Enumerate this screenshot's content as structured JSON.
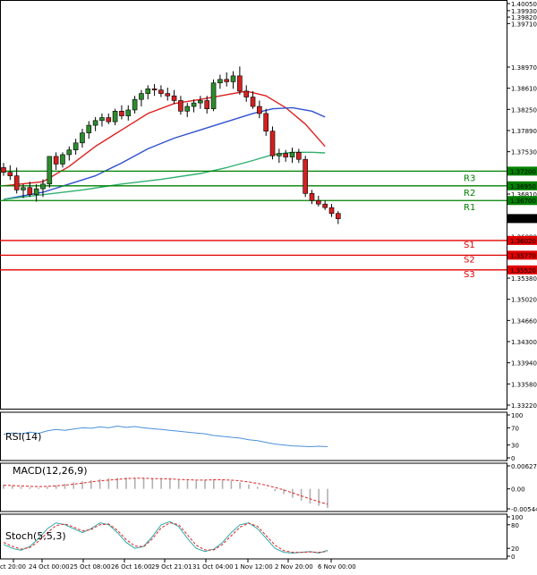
{
  "chart_data": {
    "type": "candlestick",
    "y_axis": {
      "range": [
        1.3322,
        1.4005
      ],
      "ticks": [
        "1.40050",
        "1.39930",
        "1.39820",
        "1.39710",
        "1.38970",
        "1.38610",
        "1.38250",
        "1.37890",
        "1.37530",
        "1.36810",
        "1.36090",
        "1.35380",
        "1.35020",
        "1.34660",
        "1.34300",
        "1.33940",
        "1.33580",
        "1.33220"
      ]
    },
    "x_axis_labels": [
      "ct 20:00",
      "24 Oct 00:00",
      "25 Oct 08:00",
      "26 Oct 16:00",
      "29 Oct 21:01",
      "31 Oct 04:00",
      "1 Nov 12:00",
      "2 Nov 20:00",
      "6 Nov 00:00"
    ],
    "last_price": "1.36393",
    "levels": [
      {
        "name": "R3",
        "value": 1.372,
        "label": "1.37200",
        "color": "#008000"
      },
      {
        "name": "R2",
        "value": 1.3695,
        "label": "1.36950",
        "color": "#008000"
      },
      {
        "name": "R1",
        "value": 1.367,
        "label": "1.36700",
        "color": "#008000"
      },
      {
        "name": "S1",
        "value": 1.3602,
        "label": "1.36020",
        "color": "#e00000"
      },
      {
        "name": "S2",
        "value": 1.3577,
        "label": "1.35770",
        "color": "#e00000"
      },
      {
        "name": "S3",
        "value": 1.3552,
        "label": "1.35520",
        "color": "#e00000"
      }
    ],
    "candles": [
      [
        1.3726,
        1.3734,
        1.3712,
        1.3718
      ],
      [
        1.3718,
        1.373,
        1.3705,
        1.3712
      ],
      [
        1.3712,
        1.3726,
        1.3682,
        1.3688
      ],
      [
        1.3688,
        1.3698,
        1.3674,
        1.3692
      ],
      [
        1.3692,
        1.3702,
        1.3676,
        1.368
      ],
      [
        1.368,
        1.3698,
        1.3668,
        1.369
      ],
      [
        1.369,
        1.3706,
        1.3676,
        1.3698
      ],
      [
        1.3698,
        1.3745,
        1.3692,
        1.3745
      ],
      [
        1.3745,
        1.3752,
        1.3722,
        1.3732
      ],
      [
        1.3732,
        1.3752,
        1.3726,
        1.3748
      ],
      [
        1.3748,
        1.3762,
        1.3738,
        1.3756
      ],
      [
        1.3756,
        1.3775,
        1.3748,
        1.3768
      ],
      [
        1.3768,
        1.3792,
        1.376,
        1.3785
      ],
      [
        1.3785,
        1.3805,
        1.3775,
        1.3798
      ],
      [
        1.3798,
        1.3812,
        1.3788,
        1.3806
      ],
      [
        1.3806,
        1.3818,
        1.3796,
        1.3811
      ],
      [
        1.3811,
        1.3818,
        1.38,
        1.3804
      ],
      [
        1.3804,
        1.3826,
        1.3798,
        1.3822
      ],
      [
        1.3822,
        1.3832,
        1.3808,
        1.3814
      ],
      [
        1.3814,
        1.3832,
        1.3806,
        1.3824
      ],
      [
        1.3824,
        1.3848,
        1.3818,
        1.3842
      ],
      [
        1.3842,
        1.3858,
        1.383,
        1.3852
      ],
      [
        1.3852,
        1.3866,
        1.3842,
        1.386
      ],
      [
        1.386,
        1.3868,
        1.3848,
        1.3858
      ],
      [
        1.3858,
        1.3866,
        1.3846,
        1.3852
      ],
      [
        1.3852,
        1.3862,
        1.384,
        1.3848
      ],
      [
        1.3848,
        1.3858,
        1.3834,
        1.384
      ],
      [
        1.384,
        1.3848,
        1.3816,
        1.3822
      ],
      [
        1.3822,
        1.3836,
        1.3812,
        1.383
      ],
      [
        1.383,
        1.3842,
        1.382,
        1.3836
      ],
      [
        1.3836,
        1.3848,
        1.3826,
        1.384
      ],
      [
        1.384,
        1.3848,
        1.3818,
        1.3826
      ],
      [
        1.3826,
        1.3876,
        1.3822,
        1.387
      ],
      [
        1.387,
        1.3884,
        1.386,
        1.3876
      ],
      [
        1.3876,
        1.3888,
        1.3864,
        1.3872
      ],
      [
        1.3872,
        1.389,
        1.386,
        1.3882
      ],
      [
        1.3882,
        1.3898,
        1.385,
        1.3856
      ],
      [
        1.3856,
        1.3866,
        1.3838,
        1.3846
      ],
      [
        1.3846,
        1.3856,
        1.3826,
        1.383
      ],
      [
        1.383,
        1.384,
        1.381,
        1.3818
      ],
      [
        1.3818,
        1.3826,
        1.378,
        1.3788
      ],
      [
        1.3788,
        1.3796,
        1.374,
        1.3746
      ],
      [
        1.3746,
        1.3758,
        1.3734,
        1.375
      ],
      [
        1.375,
        1.3756,
        1.3736,
        1.3744
      ],
      [
        1.3744,
        1.376,
        1.3734,
        1.3752
      ],
      [
        1.3752,
        1.3758,
        1.3734,
        1.374
      ],
      [
        1.374,
        1.3746,
        1.3676,
        1.3682
      ],
      [
        1.3682,
        1.3688,
        1.3664,
        1.367
      ],
      [
        1.367,
        1.3678,
        1.366,
        1.3664
      ],
      [
        1.3664,
        1.367,
        1.3654,
        1.3658
      ],
      [
        1.3658,
        1.3664,
        1.3642,
        1.3648
      ],
      [
        1.3648,
        1.3652,
        1.363,
        1.3639
      ]
    ],
    "series": [
      {
        "name": "MA-red",
        "color": "#e02020",
        "values": [
          [
            0,
            1.3695
          ],
          [
            6,
            1.3702
          ],
          [
            10,
            1.3728
          ],
          [
            14,
            1.3762
          ],
          [
            18,
            1.379
          ],
          [
            22,
            1.3818
          ],
          [
            26,
            1.3835
          ],
          [
            30,
            1.3842
          ],
          [
            34,
            1.385
          ],
          [
            37,
            1.3856
          ],
          [
            40,
            1.3848
          ],
          [
            43,
            1.3828
          ],
          [
            46,
            1.38
          ],
          [
            49,
            1.3762
          ]
        ]
      },
      {
        "name": "MA-blue",
        "color": "#3050d0",
        "values": [
          [
            0,
            1.3672
          ],
          [
            6,
            1.3684
          ],
          [
            10,
            1.3698
          ],
          [
            14,
            1.3712
          ],
          [
            18,
            1.3734
          ],
          [
            22,
            1.3758
          ],
          [
            26,
            1.3776
          ],
          [
            30,
            1.379
          ],
          [
            34,
            1.3804
          ],
          [
            38,
            1.3818
          ],
          [
            41,
            1.3826
          ],
          [
            44,
            1.3828
          ],
          [
            47,
            1.3822
          ],
          [
            49,
            1.3812
          ]
        ]
      },
      {
        "name": "MA-green",
        "color": "#30b070",
        "values": [
          [
            0,
            1.3672
          ],
          [
            6,
            1.368
          ],
          [
            12,
            1.3688
          ],
          [
            18,
            1.3698
          ],
          [
            24,
            1.3706
          ],
          [
            30,
            1.3716
          ],
          [
            34,
            1.3726
          ],
          [
            38,
            1.3738
          ],
          [
            41,
            1.3748
          ],
          [
            44,
            1.3752
          ],
          [
            47,
            1.3752
          ],
          [
            49,
            1.3751
          ]
        ]
      }
    ],
    "indicators": {
      "rsi": {
        "label": "RSI(14)",
        "ticks": [
          "100",
          "70",
          "30",
          "0"
        ],
        "values": [
          55,
          58,
          56,
          60,
          57,
          63,
          66,
          64,
          67,
          70,
          69,
          72,
          70,
          74,
          71,
          73,
          70,
          68,
          66,
          64,
          62,
          60,
          58,
          56,
          52,
          50,
          48,
          46,
          42,
          40,
          36,
          32,
          30,
          28,
          27,
          26,
          27,
          26
        ]
      },
      "macd": {
        "label": "MACD(12,26,9)",
        "ticks": [
          "0.006277",
          "0.00",
          "-0.005444"
        ],
        "hist": [
          0.0012,
          0.0009,
          0.0006,
          0.0004,
          0.0003,
          0.0006,
          0.001,
          0.0014,
          0.0018,
          0.0021,
          0.0024,
          0.0027,
          0.0029,
          0.003,
          0.0031,
          0.003,
          0.0029,
          0.0028,
          0.0027,
          0.0026,
          0.0024,
          0.0023,
          0.0022,
          0.0024,
          0.0026,
          0.0025,
          0.0022,
          0.0018,
          0.0012,
          0.0006,
          0.0001,
          -0.0006,
          -0.0014,
          -0.0024,
          -0.0032,
          -0.004,
          -0.0046,
          -0.0052
        ],
        "signal": [
          0.001,
          0.0009,
          0.0008,
          0.0007,
          0.0006,
          0.0007,
          0.0008,
          0.001,
          0.0013,
          0.0016,
          0.0019,
          0.0022,
          0.0024,
          0.0026,
          0.0028,
          0.0029,
          0.0029,
          0.0028,
          0.0028,
          0.0027,
          0.0026,
          0.0025,
          0.0024,
          0.0024,
          0.0025,
          0.0025,
          0.0024,
          0.0022,
          0.0019,
          0.0015,
          0.001,
          0.0004,
          -0.0003,
          -0.0011,
          -0.0019,
          -0.0027,
          -0.0035,
          -0.0042
        ]
      },
      "stoch": {
        "label": "Stoch(5,5,3)",
        "ticks": [
          "100",
          "80",
          "20",
          "0"
        ],
        "k": [
          30,
          20,
          15,
          25,
          45,
          70,
          85,
          80,
          70,
          60,
          70,
          85,
          80,
          60,
          35,
          20,
          25,
          50,
          80,
          88,
          75,
          45,
          20,
          12,
          18,
          35,
          60,
          80,
          85,
          70,
          45,
          20,
          10,
          8,
          10,
          12,
          8,
          15
        ],
        "d": [
          35,
          25,
          18,
          22,
          38,
          60,
          78,
          82,
          74,
          64,
          68,
          80,
          82,
          66,
          42,
          26,
          24,
          44,
          72,
          85,
          80,
          54,
          28,
          16,
          16,
          30,
          52,
          74,
          84,
          76,
          52,
          28,
          14,
          10,
          10,
          11,
          10,
          12
        ]
      }
    }
  }
}
